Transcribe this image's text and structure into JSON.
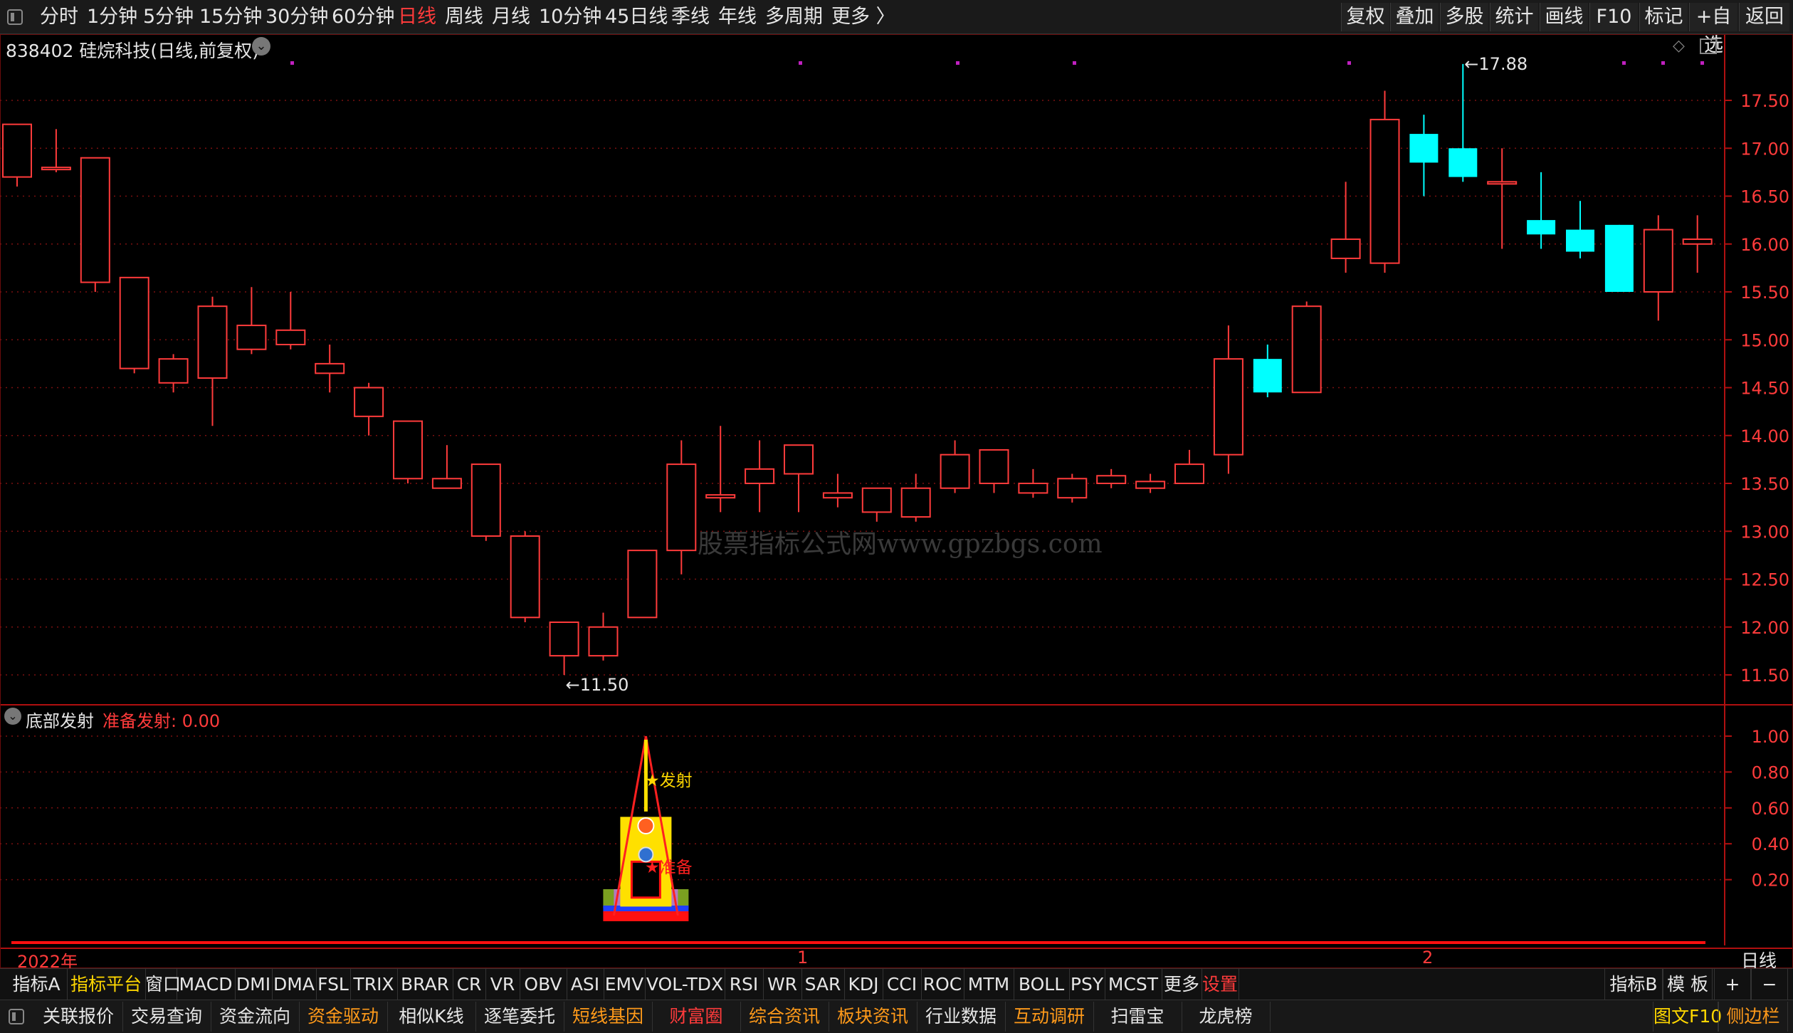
{
  "toolbar": {
    "periods": [
      {
        "label": "分时"
      },
      {
        "label": "1分钟"
      },
      {
        "label": "5分钟"
      },
      {
        "label": "15分钟"
      },
      {
        "label": "30分钟"
      },
      {
        "label": "60分钟"
      },
      {
        "label": "日线",
        "active": true
      },
      {
        "label": "周线"
      },
      {
        "label": "月线"
      },
      {
        "label": "10分钟"
      },
      {
        "label": "45日线"
      },
      {
        "label": "季线"
      },
      {
        "label": "年线"
      },
      {
        "label": "多周期"
      },
      {
        "label": "更多 〉"
      }
    ],
    "right_buttons": [
      "复权",
      "叠加",
      "多股",
      "统计",
      "画线",
      "F10",
      "标记",
      "+自选",
      "返回"
    ]
  },
  "stock": {
    "title": "838402 硅烷科技(日线,前复权)"
  },
  "watermark": "股票指标公式网www.gpzbgs.com",
  "indicator": {
    "name": "底部发射",
    "label": "准备发射: 0.00",
    "launch_text": "★发射",
    "ready_text": "★准备"
  },
  "x_axis": {
    "year_label": "2022年",
    "month_labels": [
      "1",
      "2"
    ],
    "period_label": "日线"
  },
  "chart_data": {
    "type": "candlestick",
    "title": "838402 硅烷科技(日线,前复权)",
    "price_axis": {
      "ticks": [
        "17.50",
        "17.00",
        "16.50",
        "16.00",
        "15.50",
        "15.00",
        "14.50",
        "14.00",
        "13.50",
        "13.00",
        "12.50",
        "12.00",
        "11.50"
      ],
      "range": [
        11.0,
        18.2
      ]
    },
    "candles": [
      {
        "o": 16.7,
        "h": 17.25,
        "l": 16.6,
        "c": 17.25
      },
      {
        "o": 16.78,
        "h": 17.2,
        "l": 16.75,
        "c": 16.8
      },
      {
        "o": 15.6,
        "h": 16.9,
        "l": 15.5,
        "c": 16.9
      },
      {
        "o": 14.7,
        "h": 15.65,
        "l": 14.65,
        "c": 15.65
      },
      {
        "o": 14.55,
        "h": 14.85,
        "l": 14.45,
        "c": 14.8
      },
      {
        "o": 14.6,
        "h": 15.45,
        "l": 14.1,
        "c": 15.35
      },
      {
        "o": 14.9,
        "h": 15.55,
        "l": 14.85,
        "c": 15.15
      },
      {
        "o": 14.95,
        "h": 15.5,
        "l": 14.9,
        "c": 15.1
      },
      {
        "o": 14.65,
        "h": 14.95,
        "l": 14.45,
        "c": 14.75
      },
      {
        "o": 14.2,
        "h": 14.55,
        "l": 14.0,
        "c": 14.5
      },
      {
        "o": 13.55,
        "h": 14.15,
        "l": 13.5,
        "c": 14.15
      },
      {
        "o": 13.45,
        "h": 13.9,
        "l": 13.45,
        "c": 13.55
      },
      {
        "o": 12.95,
        "h": 13.7,
        "l": 12.9,
        "c": 13.7
      },
      {
        "o": 12.1,
        "h": 13.0,
        "l": 12.05,
        "c": 12.95
      },
      {
        "o": 11.7,
        "h": 12.05,
        "l": 11.5,
        "c": 12.05
      },
      {
        "o": 11.7,
        "h": 12.15,
        "l": 11.65,
        "c": 12.0
      },
      {
        "o": 12.1,
        "h": 12.8,
        "l": 12.1,
        "c": 12.8
      },
      {
        "o": 12.8,
        "h": 13.95,
        "l": 12.55,
        "c": 13.7
      },
      {
        "o": 13.35,
        "h": 14.1,
        "l": 13.2,
        "c": 13.38
      },
      {
        "o": 13.5,
        "h": 13.95,
        "l": 13.2,
        "c": 13.65
      },
      {
        "o": 13.6,
        "h": 13.9,
        "l": 13.2,
        "c": 13.9
      },
      {
        "o": 13.35,
        "h": 13.6,
        "l": 13.25,
        "c": 13.4
      },
      {
        "o": 13.2,
        "h": 13.45,
        "l": 13.1,
        "c": 13.45
      },
      {
        "o": 13.15,
        "h": 13.6,
        "l": 13.1,
        "c": 13.45
      },
      {
        "o": 13.45,
        "h": 13.95,
        "l": 13.4,
        "c": 13.8
      },
      {
        "o": 13.5,
        "h": 13.75,
        "l": 13.4,
        "c": 13.85
      },
      {
        "o": 13.4,
        "h": 13.65,
        "l": 13.35,
        "c": 13.5
      },
      {
        "o": 13.35,
        "h": 13.6,
        "l": 13.3,
        "c": 13.55
      },
      {
        "o": 13.5,
        "h": 13.65,
        "l": 13.45,
        "c": 13.58
      },
      {
        "o": 13.45,
        "h": 13.6,
        "l": 13.4,
        "c": 13.52
      },
      {
        "o": 13.5,
        "h": 13.85,
        "l": 13.5,
        "c": 13.7
      },
      {
        "o": 13.8,
        "h": 15.15,
        "l": 13.6,
        "c": 14.8
      },
      {
        "o": 14.8,
        "h": 14.95,
        "l": 14.4,
        "c": 14.45
      },
      {
        "o": 14.45,
        "h": 15.4,
        "l": 14.45,
        "c": 15.35
      },
      {
        "o": 15.85,
        "h": 16.65,
        "l": 15.7,
        "c": 16.05
      },
      {
        "o": 15.8,
        "h": 17.6,
        "l": 15.7,
        "c": 17.3
      },
      {
        "o": 17.15,
        "h": 17.35,
        "l": 16.5,
        "c": 16.85
      },
      {
        "o": 17.0,
        "h": 17.88,
        "l": 16.65,
        "c": 16.7
      },
      {
        "o": 16.65,
        "h": 17.0,
        "l": 15.95,
        "c": 16.65
      },
      {
        "o": 16.25,
        "h": 16.75,
        "l": 15.95,
        "c": 16.1
      },
      {
        "o": 16.15,
        "h": 16.45,
        "l": 15.85,
        "c": 15.92
      },
      {
        "o": 16.2,
        "h": 16.2,
        "l": 15.5,
        "c": 15.5
      },
      {
        "o": 15.5,
        "h": 16.3,
        "l": 15.2,
        "c": 16.15
      },
      {
        "o": 16.0,
        "h": 16.3,
        "l": 15.7,
        "c": 16.05
      }
    ],
    "annotations": [
      {
        "text": "←11.50",
        "price": 11.5,
        "candle": 14
      },
      {
        "text": "←17.88",
        "price": 17.88,
        "candle": 37
      }
    ],
    "indicator_axis": {
      "ticks": [
        "1.00",
        "0.80",
        "0.60",
        "0.40",
        "0.20"
      ],
      "range": [
        0,
        1.2
      ]
    },
    "indicator_signal_candle": 16
  },
  "tabs": [
    {
      "label": "指标A"
    },
    {
      "label": "指标平台",
      "style": "yellow"
    },
    {
      "label": "窗口"
    },
    {
      "label": "MACD"
    },
    {
      "label": "DMI"
    },
    {
      "label": "DMA"
    },
    {
      "label": "FSL"
    },
    {
      "label": "TRIX"
    },
    {
      "label": "BRAR"
    },
    {
      "label": "CR"
    },
    {
      "label": "VR"
    },
    {
      "label": "OBV"
    },
    {
      "label": "ASI"
    },
    {
      "label": "EMV"
    },
    {
      "label": "VOL-TDX"
    },
    {
      "label": "RSI"
    },
    {
      "label": "WR"
    },
    {
      "label": "SAR"
    },
    {
      "label": "KDJ"
    },
    {
      "label": "CCI"
    },
    {
      "label": "ROC"
    },
    {
      "label": "MTM"
    },
    {
      "label": "BOLL"
    },
    {
      "label": "PSY"
    },
    {
      "label": "MCST"
    },
    {
      "label": "更多"
    },
    {
      "label": "设置",
      "style": "red"
    }
  ],
  "tabs_right": [
    "指标B",
    "模 板",
    "+",
    "−"
  ],
  "bottom": [
    {
      "label": "关联报价"
    },
    {
      "label": "交易查询"
    },
    {
      "label": "资金流向"
    },
    {
      "label": "资金驱动",
      "style": "orange"
    },
    {
      "label": "相似K线"
    },
    {
      "label": "逐笔委托"
    },
    {
      "label": "短线基因",
      "style": "orange"
    },
    {
      "label": "财富圈",
      "style": "red"
    },
    {
      "label": "综合资讯",
      "style": "orange"
    },
    {
      "label": "板块资讯",
      "style": "orange"
    },
    {
      "label": "行业数据"
    },
    {
      "label": "互动调研",
      "style": "orange"
    },
    {
      "label": "扫雷宝"
    },
    {
      "label": "龙虎榜"
    }
  ],
  "bottom_right": [
    {
      "label": "图文F10",
      "style": "yellow2"
    },
    {
      "label": "侧边栏",
      "style": "orange"
    }
  ],
  "colors": {
    "up": "#ff3b3b",
    "down": "#00ffff",
    "grid": "#7a1010",
    "purple": "#c020c0"
  }
}
